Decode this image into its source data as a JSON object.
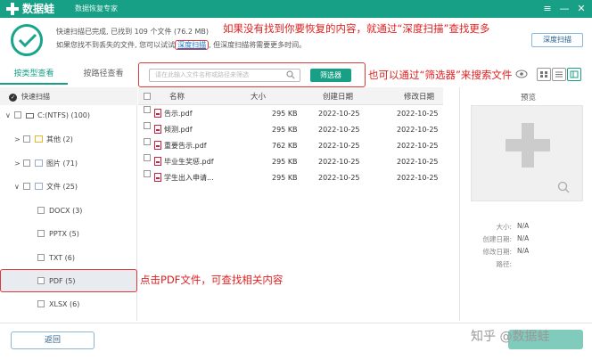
{
  "titlebar": {
    "app_name": "数据蛙",
    "subtitle": "数据恢复专家",
    "controls": [
      "≡",
      "—",
      "✕"
    ]
  },
  "summary": {
    "line1": "快速扫描已完成, 已找到 109 个文件 (76.2 MB)",
    "line2_prefix": "如果您找不到丢失的文件, 您可以试试",
    "deep_scan_link": "深度扫描",
    "line2_suffix": ", 但深度扫描将需要更多时间。",
    "deep_scan_button": "深度扫描"
  },
  "annotations": {
    "deep_scan_hint": "如果没有找到你要恢复的内容，就通过“深度扫描”查找更多",
    "filter_hint": "也可以通过“筛选器”来搜索文件",
    "pdf_hint": "点击PDF文件，可查找相关内容"
  },
  "tabs": [
    {
      "label": "按类型查看"
    },
    {
      "label": "按路径查看"
    }
  ],
  "search": {
    "placeholder": "请在此输入文件名称或路径来筛选",
    "filter_button": "筛选器"
  },
  "tree": {
    "quick_scan": "快速扫描",
    "items": [
      {
        "label": "C:(NTFS) (100)"
      },
      {
        "label": "其他 (2)"
      },
      {
        "label": "图片 (71)"
      },
      {
        "label": "文件 (25)"
      },
      {
        "label": "DOCX (3)"
      },
      {
        "label": "PPTX (5)"
      },
      {
        "label": "TXT (6)"
      },
      {
        "label": "PDF (5)"
      },
      {
        "label": "XLSX (6)"
      }
    ]
  },
  "table": {
    "headers": {
      "name": "名称",
      "size": "大小",
      "created": "创建日期",
      "modified": "修改日期"
    },
    "rows": [
      {
        "name": "告示.pdf",
        "size": "295 KB",
        "created": "2022-10-25",
        "modified": "2022-10-25"
      },
      {
        "name": "倾测.pdf",
        "size": "295 KB",
        "created": "2022-10-25",
        "modified": "2022-10-25"
      },
      {
        "name": "重要告示.pdf",
        "size": "762 KB",
        "created": "2022-10-25",
        "modified": "2022-10-25"
      },
      {
        "name": "毕业生奖惩.pdf",
        "size": "295 KB",
        "created": "2022-10-25",
        "modified": "2022-10-25"
      },
      {
        "name": "学生出入申请...",
        "size": "295 KB",
        "created": "2022-10-25",
        "modified": "2022-10-25"
      }
    ]
  },
  "preview": {
    "title": "预览",
    "meta": [
      {
        "label": "大小:",
        "value": "N/A"
      },
      {
        "label": "创建日期:",
        "value": "N/A"
      },
      {
        "label": "修改日期:",
        "value": "N/A"
      },
      {
        "label": "路径:",
        "value": ""
      }
    ]
  },
  "bottom": {
    "back_button": "返回",
    "watermark": "知乎 @数据蛙"
  },
  "colors": {
    "accent": "#17a085",
    "annotation": "#e02020"
  }
}
